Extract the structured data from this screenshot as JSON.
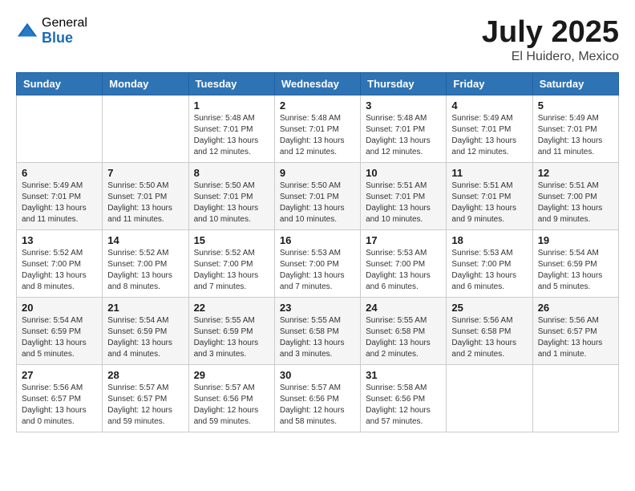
{
  "header": {
    "logo_general": "General",
    "logo_blue": "Blue",
    "title": "July 2025",
    "subtitle": "El Huidero, Mexico"
  },
  "days_of_week": [
    "Sunday",
    "Monday",
    "Tuesday",
    "Wednesday",
    "Thursday",
    "Friday",
    "Saturday"
  ],
  "weeks": [
    [
      {
        "day": "",
        "info": ""
      },
      {
        "day": "",
        "info": ""
      },
      {
        "day": "1",
        "info": "Sunrise: 5:48 AM\nSunset: 7:01 PM\nDaylight: 13 hours\nand 12 minutes."
      },
      {
        "day": "2",
        "info": "Sunrise: 5:48 AM\nSunset: 7:01 PM\nDaylight: 13 hours\nand 12 minutes."
      },
      {
        "day": "3",
        "info": "Sunrise: 5:48 AM\nSunset: 7:01 PM\nDaylight: 13 hours\nand 12 minutes."
      },
      {
        "day": "4",
        "info": "Sunrise: 5:49 AM\nSunset: 7:01 PM\nDaylight: 13 hours\nand 12 minutes."
      },
      {
        "day": "5",
        "info": "Sunrise: 5:49 AM\nSunset: 7:01 PM\nDaylight: 13 hours\nand 11 minutes."
      }
    ],
    [
      {
        "day": "6",
        "info": "Sunrise: 5:49 AM\nSunset: 7:01 PM\nDaylight: 13 hours\nand 11 minutes."
      },
      {
        "day": "7",
        "info": "Sunrise: 5:50 AM\nSunset: 7:01 PM\nDaylight: 13 hours\nand 11 minutes."
      },
      {
        "day": "8",
        "info": "Sunrise: 5:50 AM\nSunset: 7:01 PM\nDaylight: 13 hours\nand 10 minutes."
      },
      {
        "day": "9",
        "info": "Sunrise: 5:50 AM\nSunset: 7:01 PM\nDaylight: 13 hours\nand 10 minutes."
      },
      {
        "day": "10",
        "info": "Sunrise: 5:51 AM\nSunset: 7:01 PM\nDaylight: 13 hours\nand 10 minutes."
      },
      {
        "day": "11",
        "info": "Sunrise: 5:51 AM\nSunset: 7:01 PM\nDaylight: 13 hours\nand 9 minutes."
      },
      {
        "day": "12",
        "info": "Sunrise: 5:51 AM\nSunset: 7:00 PM\nDaylight: 13 hours\nand 9 minutes."
      }
    ],
    [
      {
        "day": "13",
        "info": "Sunrise: 5:52 AM\nSunset: 7:00 PM\nDaylight: 13 hours\nand 8 minutes."
      },
      {
        "day": "14",
        "info": "Sunrise: 5:52 AM\nSunset: 7:00 PM\nDaylight: 13 hours\nand 8 minutes."
      },
      {
        "day": "15",
        "info": "Sunrise: 5:52 AM\nSunset: 7:00 PM\nDaylight: 13 hours\nand 7 minutes."
      },
      {
        "day": "16",
        "info": "Sunrise: 5:53 AM\nSunset: 7:00 PM\nDaylight: 13 hours\nand 7 minutes."
      },
      {
        "day": "17",
        "info": "Sunrise: 5:53 AM\nSunset: 7:00 PM\nDaylight: 13 hours\nand 6 minutes."
      },
      {
        "day": "18",
        "info": "Sunrise: 5:53 AM\nSunset: 7:00 PM\nDaylight: 13 hours\nand 6 minutes."
      },
      {
        "day": "19",
        "info": "Sunrise: 5:54 AM\nSunset: 6:59 PM\nDaylight: 13 hours\nand 5 minutes."
      }
    ],
    [
      {
        "day": "20",
        "info": "Sunrise: 5:54 AM\nSunset: 6:59 PM\nDaylight: 13 hours\nand 5 minutes."
      },
      {
        "day": "21",
        "info": "Sunrise: 5:54 AM\nSunset: 6:59 PM\nDaylight: 13 hours\nand 4 minutes."
      },
      {
        "day": "22",
        "info": "Sunrise: 5:55 AM\nSunset: 6:59 PM\nDaylight: 13 hours\nand 3 minutes."
      },
      {
        "day": "23",
        "info": "Sunrise: 5:55 AM\nSunset: 6:58 PM\nDaylight: 13 hours\nand 3 minutes."
      },
      {
        "day": "24",
        "info": "Sunrise: 5:55 AM\nSunset: 6:58 PM\nDaylight: 13 hours\nand 2 minutes."
      },
      {
        "day": "25",
        "info": "Sunrise: 5:56 AM\nSunset: 6:58 PM\nDaylight: 13 hours\nand 2 minutes."
      },
      {
        "day": "26",
        "info": "Sunrise: 5:56 AM\nSunset: 6:57 PM\nDaylight: 13 hours\nand 1 minute."
      }
    ],
    [
      {
        "day": "27",
        "info": "Sunrise: 5:56 AM\nSunset: 6:57 PM\nDaylight: 13 hours\nand 0 minutes."
      },
      {
        "day": "28",
        "info": "Sunrise: 5:57 AM\nSunset: 6:57 PM\nDaylight: 12 hours\nand 59 minutes."
      },
      {
        "day": "29",
        "info": "Sunrise: 5:57 AM\nSunset: 6:56 PM\nDaylight: 12 hours\nand 59 minutes."
      },
      {
        "day": "30",
        "info": "Sunrise: 5:57 AM\nSunset: 6:56 PM\nDaylight: 12 hours\nand 58 minutes."
      },
      {
        "day": "31",
        "info": "Sunrise: 5:58 AM\nSunset: 6:56 PM\nDaylight: 12 hours\nand 57 minutes."
      },
      {
        "day": "",
        "info": ""
      },
      {
        "day": "",
        "info": ""
      }
    ]
  ]
}
